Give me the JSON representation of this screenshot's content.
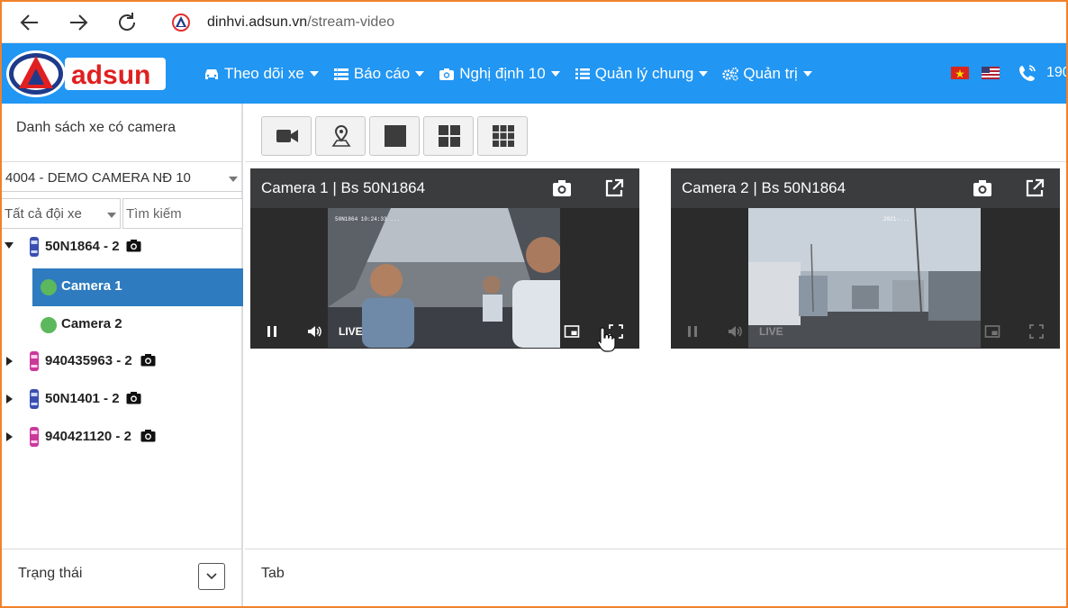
{
  "browser": {
    "url_host": "dinhvi.adsun.vn",
    "url_path": "/stream-video"
  },
  "header": {
    "logo_text": "adsun",
    "menu": [
      {
        "label": "Theo dõi xe",
        "icon": "car-icon"
      },
      {
        "label": "Báo cáo",
        "icon": "report-icon"
      },
      {
        "label": "Nghị định 10",
        "icon": "camera-icon"
      },
      {
        "label": "Quản lý chung",
        "icon": "list-icon"
      },
      {
        "label": "Quản trị",
        "icon": "gears-icon"
      }
    ],
    "phone": "190",
    "colors": {
      "primary": "#2196f3",
      "selected": "#2e7bbf",
      "online": "#5cb85c"
    }
  },
  "sidebar": {
    "title": "Danh sách xe có camera",
    "company": "4004 - DEMO CAMERA NĐ 10",
    "team_filter": "Tất cả đội xe",
    "search_placeholder": "Tìm kiếm",
    "vehicles": [
      {
        "label": "50N1864 - 2",
        "expanded": true,
        "color": "#3a4fb0",
        "cameras": [
          {
            "label": "Camera 1",
            "selected": true
          },
          {
            "label": "Camera 2",
            "selected": false
          }
        ]
      },
      {
        "label": "940435963 - 2",
        "expanded": false,
        "color": "#c9399a"
      },
      {
        "label": "50N1401 - 2",
        "expanded": false,
        "color": "#3a4fb0"
      },
      {
        "label": "940421120 - 2",
        "expanded": false,
        "color": "#c9399a"
      }
    ],
    "footer_label": "Trạng thái"
  },
  "toolbar": {
    "buttons": [
      "video-camera-icon",
      "map-marker-icon",
      "layout-1-icon",
      "layout-4-icon",
      "layout-9-icon"
    ]
  },
  "cameras": [
    {
      "title": "Camera 1 | Bs 50N1864",
      "live_label": "LIVE"
    },
    {
      "title": "Camera 2 | Bs 50N1864",
      "live_label": "LIVE"
    }
  ],
  "main_footer": {
    "label": "Tab"
  }
}
